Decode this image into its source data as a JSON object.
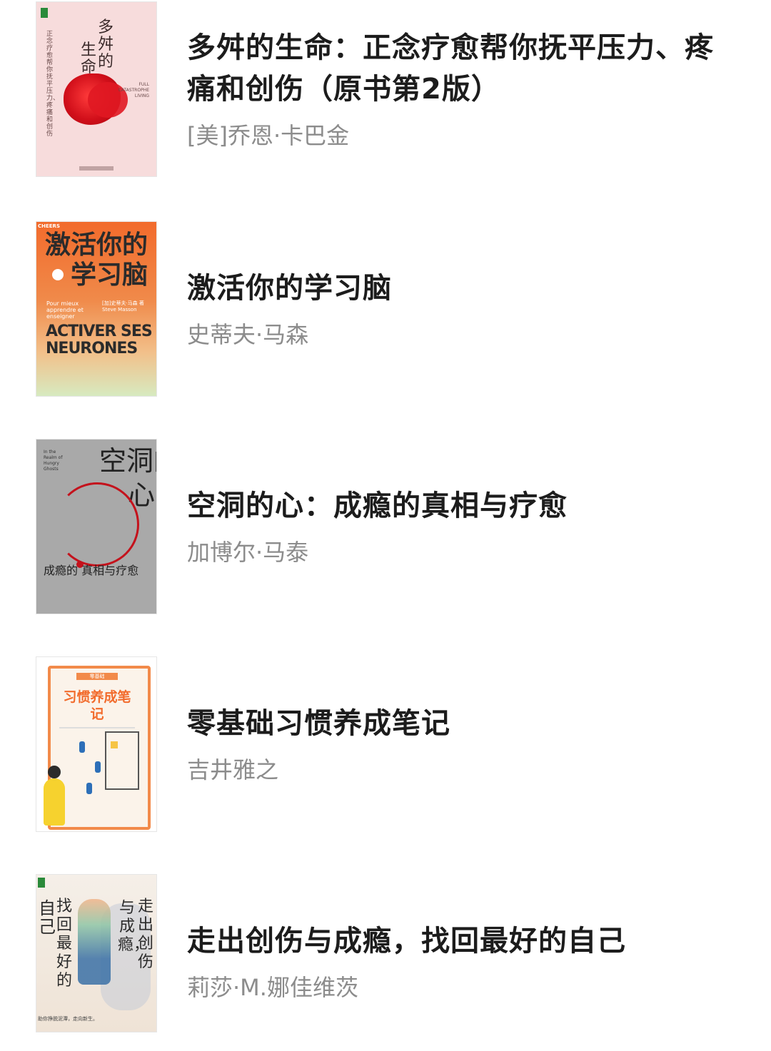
{
  "books": [
    {
      "title": "多舛的生命：正念疗愈帮你抚平压力、疼痛和创伤（原书第2版）",
      "author": "[美]乔恩·卡巴金",
      "cover": {
        "title_line_1": "多舛的",
        "title_line_2": "生命",
        "english": "FULL CATASTROPHE LIVING",
        "subtitle": "正念疗愈帮你抚平压力、疼痛和创伤"
      }
    },
    {
      "title": "激活你的学习脑",
      "author": "史蒂夫·马森",
      "cover": {
        "publisher_tag": "CHEERS",
        "title_line_1": "激活你的",
        "title_line_2": "学习脑",
        "french_sub": "Pour mieux apprendre et enseigner",
        "author_line": "[加]史蒂夫·马森 著 Steve Masson",
        "english": "ACTIVER SES NEURONES"
      }
    },
    {
      "title": "空洞的心：成瘾的真相与疗愈",
      "author": "加博尔·马泰",
      "cover": {
        "title_line_1": "空洞的",
        "title_line_2": "心",
        "english": "In the Realm of Hungry Ghosts",
        "subtitle": "成瘾的 真相与疗愈"
      }
    },
    {
      "title": "零基础习惯养成笔记",
      "author": "吉井雅之",
      "cover": {
        "tag": "零基础",
        "title": "习惯养成笔记"
      }
    },
    {
      "title": "走出创伤与成瘾，找回最好的自己",
      "author": "莉莎·M.娜佳维茨",
      "cover": {
        "left_text_1": "自己",
        "left_text_2": "找回最好的",
        "right_text_1": "与成瘾，",
        "right_text_2": "走出创伤",
        "bottom": "助你挣脱泥潭，走向新生。"
      }
    }
  ]
}
